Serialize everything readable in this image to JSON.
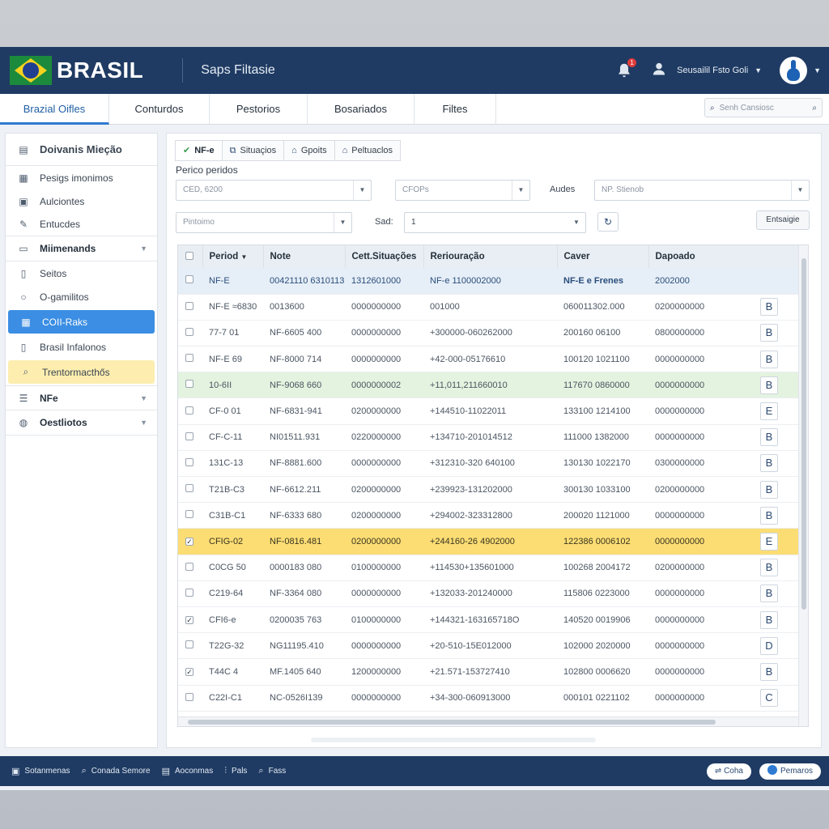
{
  "header": {
    "brand": "BRASIL",
    "title": "Saps Filtasie",
    "notif_count": "1",
    "user_name": "Seusailil Fsto Goli"
  },
  "tabs": [
    {
      "label": "Brazial Oifles"
    },
    {
      "label": "Conturdos"
    },
    {
      "label": "Pestorios"
    },
    {
      "label": "Bosariados"
    },
    {
      "label": "Filtes"
    }
  ],
  "search": {
    "placeholder": "Senh Cansiosc"
  },
  "sidebar": {
    "head": "Doivanis Mieção",
    "items": [
      {
        "label": "Pesigs imonimos",
        "icon": "calendar-icon"
      },
      {
        "label": "Aulciontes",
        "icon": "report-icon"
      },
      {
        "label": "Entucdes",
        "icon": "edit-icon"
      },
      {
        "label": "Miimenands",
        "icon": "chart-icon"
      },
      {
        "label": "Seitos",
        "icon": "document-icon"
      },
      {
        "label": "O-gamilitos",
        "icon": "circle-icon"
      },
      {
        "label": "COII-Raks",
        "icon": "grid-icon"
      },
      {
        "label": "Brasil Infalonos",
        "icon": "document-icon"
      },
      {
        "label": "Trentormacthős",
        "icon": "search-icon"
      },
      {
        "label": "NFe",
        "icon": "list-icon"
      },
      {
        "label": "Oestliotos",
        "icon": "globe-icon"
      }
    ]
  },
  "subtabs": [
    {
      "label": "NF-e"
    },
    {
      "label": "Situaçios"
    },
    {
      "label": "Gpoits"
    },
    {
      "label": "Peltuaclos"
    }
  ],
  "filters": {
    "period_label": "Perico peridos",
    "field1": "CED, 6200",
    "field2": "CFOPs",
    "label_acides": "Audes",
    "field3": "NP. Stienob",
    "field4": "Pintoimo",
    "label_sad": "Sad:",
    "field5": "1",
    "action_button": "Entsaigie"
  },
  "table": {
    "columns": [
      "Period",
      "Note",
      "Cett.Situações",
      "Reriouração",
      "Caver",
      "Dapoado"
    ],
    "rows": [
      {
        "checked": false,
        "period": "NF-E",
        "note": "00421110 6310113",
        "sit": "1312601000",
        "rer": "NF-e 1100002000",
        "caver": "NF-E e Frenes",
        "dap": "2002000",
        "btn": "",
        "style": "sel"
      },
      {
        "checked": false,
        "period": "NF-E ≈6830",
        "note": "0013600",
        "sit": "0000000000",
        "rer": "001000",
        "caver": "060011302.000",
        "dap": "0200000000",
        "btn": "B",
        "style": ""
      },
      {
        "checked": false,
        "period": "77-7 01",
        "note": "NF-6605 400",
        "sit": "0000000000",
        "rer": "+300000-060262000",
        "caver": "200160 06100",
        "dap": "0800000000",
        "btn": "B",
        "style": ""
      },
      {
        "checked": false,
        "period": "NF-E 69",
        "note": "NF-8000 714",
        "sit": "0000000000",
        "rer": "+42-000-05176610",
        "caver": "100120 1021100",
        "dap": "0000000000",
        "btn": "B",
        "style": ""
      },
      {
        "checked": false,
        "period": "10-6II",
        "note": "NF-9068 660",
        "sit": "0000000002",
        "rer": "+11,011,211660010",
        "caver": "117670 0860000",
        "dap": "0000000000",
        "btn": "B",
        "style": "green"
      },
      {
        "checked": false,
        "period": "CF-0 01",
        "note": "NF-6831-941",
        "sit": "0200000000",
        "rer": "+144510-11022011",
        "caver": "133100 1214100",
        "dap": "0000000000",
        "btn": "E",
        "style": ""
      },
      {
        "checked": false,
        "period": "CF-C-11",
        "note": "NI01511.931",
        "sit": "0220000000",
        "rer": "+134710-201014512",
        "caver": "111000 1382000",
        "dap": "0000000000",
        "btn": "B",
        "style": ""
      },
      {
        "checked": false,
        "period": "131C-13",
        "note": "NF-8881.600",
        "sit": "0000000000",
        "rer": "+312310-320 640100",
        "caver": "130130 1022170",
        "dap": "0300000000",
        "btn": "B",
        "style": ""
      },
      {
        "checked": false,
        "period": "T21B-C3",
        "note": "NF-6612.211",
        "sit": "0200000000",
        "rer": "+239923-131202000",
        "caver": "300130 1033100",
        "dap": "0200000000",
        "btn": "B",
        "style": ""
      },
      {
        "checked": false,
        "period": "C31B-C1",
        "note": "NF-6333 680",
        "sit": "0200000000",
        "rer": "+294002-323312800",
        "caver": "200020 1121000",
        "dap": "0000000000",
        "btn": "B",
        "style": ""
      },
      {
        "checked": true,
        "period": "CFIG-02",
        "note": "NF-0816.481",
        "sit": "0200000000",
        "rer": "+244160-26 4902000",
        "caver": "122386 0006102",
        "dap": "0000000000",
        "btn": "E",
        "style": "yellow"
      },
      {
        "checked": false,
        "period": "C0CG 50",
        "note": "0000183 080",
        "sit": "0100000000",
        "rer": "+114530+135601000",
        "caver": "100268 2004172",
        "dap": "0200000000",
        "btn": "B",
        "style": ""
      },
      {
        "checked": false,
        "period": "C219-64",
        "note": "NF-3364 080",
        "sit": "0000000000",
        "rer": "+132033-201240000",
        "caver": "115806 0223000",
        "dap": "0000000000",
        "btn": "B",
        "style": ""
      },
      {
        "checked": true,
        "period": "CFI6-e",
        "note": "0200035 763",
        "sit": "0100000000",
        "rer": "+144321-163165718O",
        "caver": "140520 0019906",
        "dap": "0000000000",
        "btn": "B",
        "style": ""
      },
      {
        "checked": false,
        "period": "T22G-32",
        "note": "NG11195.410",
        "sit": "0000000000",
        "rer": "+20-510-15E012000",
        "caver": "102000 2020000",
        "dap": "0000000000",
        "btn": "D",
        "style": ""
      },
      {
        "checked": true,
        "period": "T44C 4",
        "note": "MF.1405 640",
        "sit": "1200000000",
        "rer": "+21.571-153727410",
        "caver": "102800 0006620",
        "dap": "0000000000",
        "btn": "B",
        "style": ""
      },
      {
        "checked": false,
        "period": "C22I-C1",
        "note": "NC-0526I139",
        "sit": "0000000000",
        "rer": "+34-300-060913000",
        "caver": "000101 0221102",
        "dap": "0000000000",
        "btn": "C",
        "style": ""
      }
    ]
  },
  "footer": {
    "items": [
      {
        "label": "Sotanmenas",
        "icon": "lock-icon"
      },
      {
        "label": "Conada Semore",
        "icon": "search-icon"
      },
      {
        "label": "Aoconmas",
        "icon": "message-icon"
      },
      {
        "label": "Pals",
        "icon": "filter-icon"
      },
      {
        "label": "Fass",
        "icon": "search-icon"
      }
    ],
    "btn1": "Coha",
    "btn2": "Pemaros"
  },
  "colors": {
    "header_bg": "#1f3b63",
    "accent": "#3b8ee3",
    "row_highlight_yellow": "#fbdd74",
    "row_highlight_green": "#e3f3df"
  }
}
